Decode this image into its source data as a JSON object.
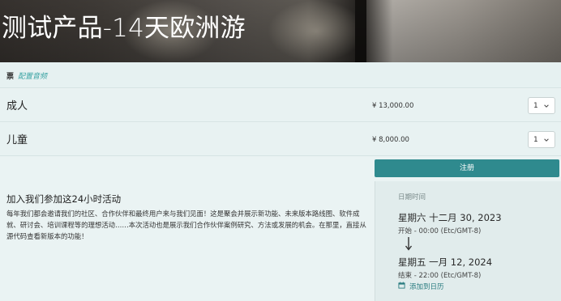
{
  "event": {
    "title": "测试产品-14天欧洲游"
  },
  "tickets": {
    "label": "票",
    "config_link": "配置音频",
    "rows": [
      {
        "name": "成人",
        "price": "¥ 13,000.00",
        "quantity": "1"
      },
      {
        "name": "儿童",
        "price": "¥ 8,000.00",
        "quantity": "1"
      }
    ]
  },
  "register": {
    "label": "注册"
  },
  "about": {
    "title": "加入我们参加这24小时活动",
    "text": "每年我们都会邀请我们的社区、合作伙伴和最终用户来与我们见面！这是聚会并展示新功能、未来版本路线图、软件成就、研讨会、培训课程等的理想活动……本次活动也是展示我们合作伙伴案例研究、方法或发展的机会。在那里，直接从源代码查看新版本的功能！"
  },
  "schedule": {
    "label": "日期时间",
    "start_date": "星期六 十二月 30, 2023",
    "start_time": "开始 - 00:00 (Etc/GMT-8)",
    "end_date": "星期五 一月 12, 2024",
    "end_time": "结束 - 22:00 (Etc/GMT-8)",
    "add_to_calendar": "添加到日历"
  },
  "icons": {
    "quantity_dropdown": "chevron-down-icon",
    "arrow": "arrow-down-icon",
    "calendar": "calendar-icon"
  },
  "colors": {
    "accent": "#2f8a8e",
    "link": "#3aa3a3",
    "background": "#eaf3f3"
  }
}
